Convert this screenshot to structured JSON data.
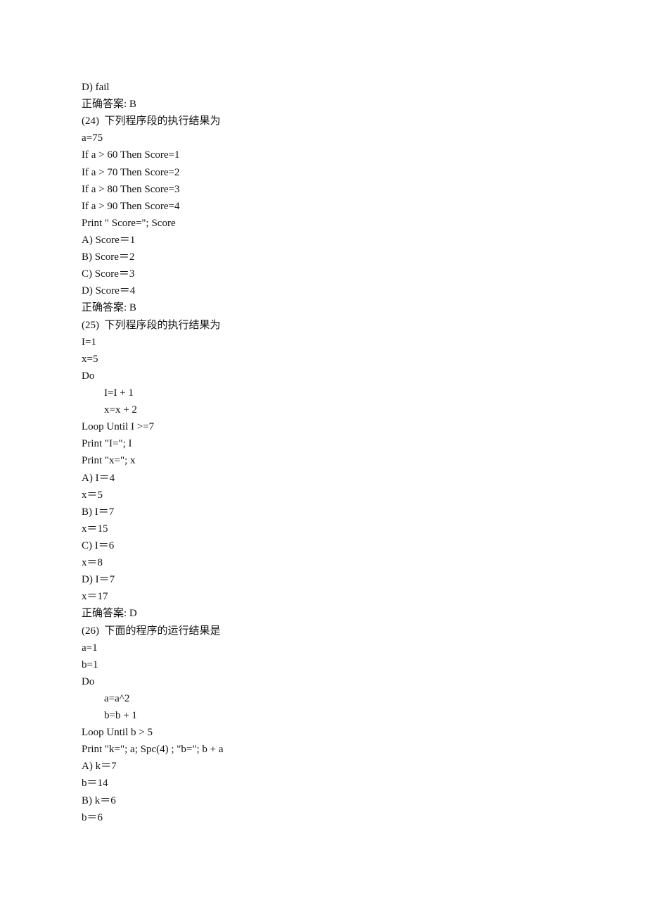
{
  "document": {
    "lines": [
      {
        "text": "D) fail",
        "type": "option",
        "indent": false
      },
      {
        "text": "正确答案: B",
        "type": "answer",
        "indent": false
      },
      {
        "text": "(24)  下列程序段的执行结果为",
        "type": "question",
        "indent": false
      },
      {
        "text": "a=75",
        "type": "code",
        "indent": false
      },
      {
        "text": "If a > 60 Then Score=1",
        "type": "code",
        "indent": false
      },
      {
        "text": "If a > 70 Then Score=2",
        "type": "code",
        "indent": false
      },
      {
        "text": "If a > 80 Then Score=3",
        "type": "code",
        "indent": false
      },
      {
        "text": "If a > 90 Then Score=4",
        "type": "code",
        "indent": false
      },
      {
        "text": "Print \" Score=\"; Score",
        "type": "code",
        "indent": false
      },
      {
        "text": "A) Score＝1",
        "type": "option",
        "indent": false
      },
      {
        "text": "B) Score＝2",
        "type": "option",
        "indent": false
      },
      {
        "text": "C) Score＝3",
        "type": "option",
        "indent": false
      },
      {
        "text": "D) Score＝4",
        "type": "option",
        "indent": false
      },
      {
        "text": "正确答案: B",
        "type": "answer",
        "indent": false
      },
      {
        "text": "(25)  下列程序段的执行结果为",
        "type": "question",
        "indent": false
      },
      {
        "text": "I=1",
        "type": "code",
        "indent": false
      },
      {
        "text": "x=5",
        "type": "code",
        "indent": false
      },
      {
        "text": "Do",
        "type": "code",
        "indent": false
      },
      {
        "text": "I=I + 1",
        "type": "code",
        "indent": true
      },
      {
        "text": "x=x + 2",
        "type": "code",
        "indent": true
      },
      {
        "text": "Loop Until I >=7",
        "type": "code",
        "indent": false
      },
      {
        "text": "Print \"I=\"; I",
        "type": "code",
        "indent": false
      },
      {
        "text": "Print \"x=\"; x",
        "type": "code",
        "indent": false
      },
      {
        "text": "A) I＝4",
        "type": "option",
        "indent": false
      },
      {
        "text": "x＝5",
        "type": "option",
        "indent": false
      },
      {
        "text": "B) I＝7",
        "type": "option",
        "indent": false
      },
      {
        "text": "x＝15",
        "type": "option",
        "indent": false
      },
      {
        "text": "C) I＝6",
        "type": "option",
        "indent": false
      },
      {
        "text": "x＝8",
        "type": "option",
        "indent": false
      },
      {
        "text": "D) I＝7",
        "type": "option",
        "indent": false
      },
      {
        "text": "x＝17",
        "type": "option",
        "indent": false
      },
      {
        "text": "正确答案: D",
        "type": "answer",
        "indent": false
      },
      {
        "text": "(26)  下面的程序的运行结果是",
        "type": "question",
        "indent": false
      },
      {
        "text": "a=1",
        "type": "code",
        "indent": false
      },
      {
        "text": "b=1",
        "type": "code",
        "indent": false
      },
      {
        "text": "Do",
        "type": "code",
        "indent": false
      },
      {
        "text": "a=a^2",
        "type": "code",
        "indent": true
      },
      {
        "text": "b=b + 1",
        "type": "code",
        "indent": true
      },
      {
        "text": "Loop Until b > 5",
        "type": "code",
        "indent": false
      },
      {
        "text": "Print \"k=\"; a; Spc(4) ; \"b=\"; b + a",
        "type": "code",
        "indent": false
      },
      {
        "text": "A) k＝7",
        "type": "option",
        "indent": false
      },
      {
        "text": "b＝14",
        "type": "option",
        "indent": false
      },
      {
        "text": "B) k＝6",
        "type": "option",
        "indent": false
      },
      {
        "text": "b＝6",
        "type": "option",
        "indent": false
      }
    ]
  }
}
